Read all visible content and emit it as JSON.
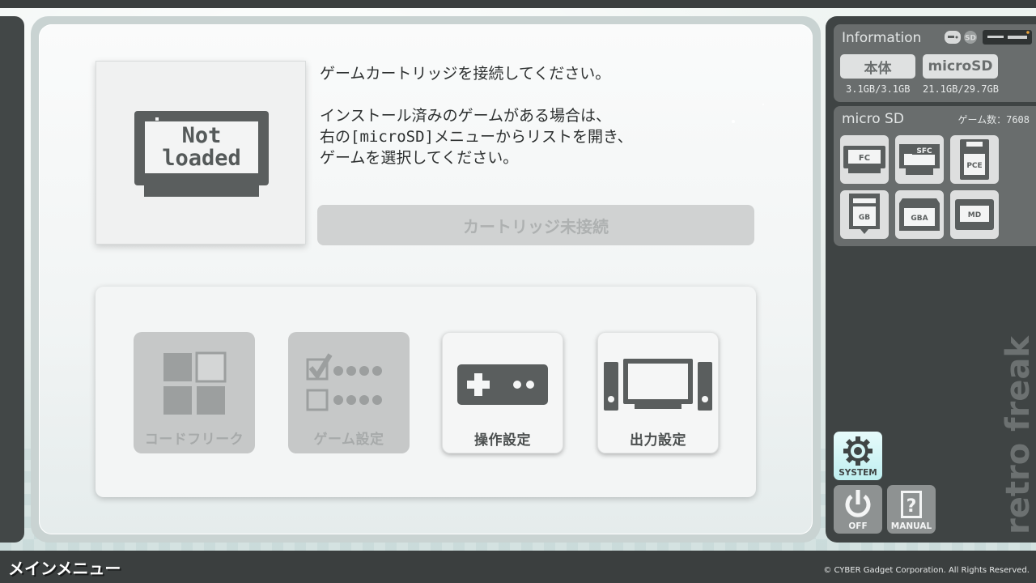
{
  "thumbnail": {
    "line1": "Not",
    "line2": "loaded"
  },
  "message": {
    "line1": "ゲームカートリッジを接続してください。",
    "line2": "インストール済みのゲームがある場合は、\n右の[microSD]メニューからリストを開き、\nゲームを選択してください。"
  },
  "status_button": "カートリッジ未接続",
  "menu": [
    {
      "label": "コードフリーク",
      "enabled": false,
      "icon": "code-freak-icon"
    },
    {
      "label": "ゲーム設定",
      "enabled": false,
      "icon": "game-settings-icon"
    },
    {
      "label": "操作設定",
      "enabled": true,
      "icon": "controller-icon"
    },
    {
      "label": "出力設定",
      "enabled": true,
      "icon": "tv-output-icon"
    }
  ],
  "info": {
    "title": "Information",
    "internal": {
      "label": "本体",
      "value": "3.1GB/3.1GB"
    },
    "microsd": {
      "label": "microSD",
      "value": "21.1GB/29.7GB"
    }
  },
  "sd_panel": {
    "title": "micro SD",
    "count_label": "ゲーム数：7608",
    "consoles": [
      "FC",
      "SFC",
      "PCE",
      "GB",
      "GBA",
      "MD"
    ]
  },
  "system_buttons": {
    "system": "SYSTEM",
    "off": "OFF",
    "manual": "MANUAL"
  },
  "brand": "retro freak",
  "footer": {
    "screen_title": "メインメニュー",
    "copyright": "© CYBER Gadget Corporation. All Rights Reserved."
  },
  "colors": {
    "dark": "#3f4444",
    "panel_gray": "#696d6d",
    "icon_gray": "#5a5e5e",
    "system_accent": "#bfeff0"
  }
}
